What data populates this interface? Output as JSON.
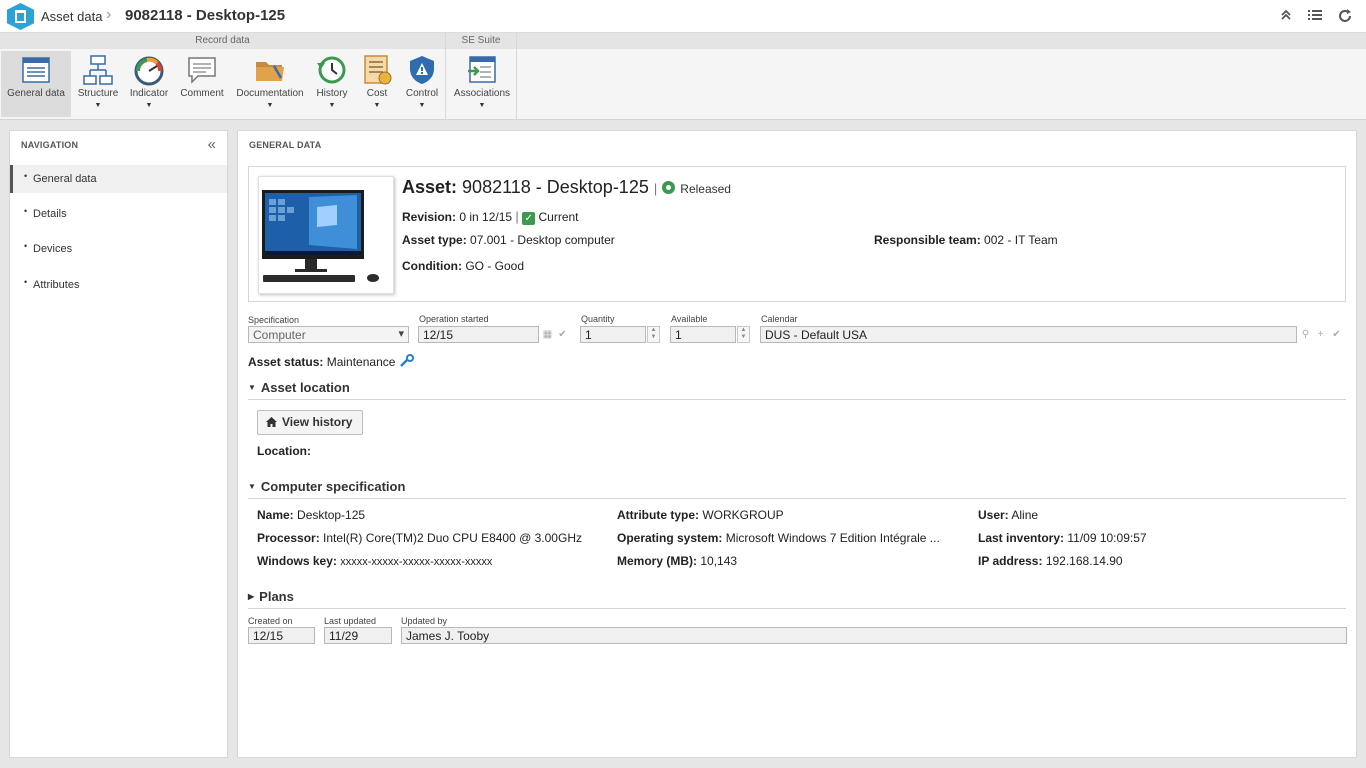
{
  "titlebar": {
    "breadcrumb_root": "Asset data",
    "separator": "›",
    "title": "9082118 - Desktop-125"
  },
  "ribbon": {
    "groups": [
      {
        "label": "Record data"
      },
      {
        "label": "SE Suite"
      }
    ],
    "buttons": [
      {
        "label": "General data",
        "icon": "form-icon",
        "active": true
      },
      {
        "label": "Structure",
        "icon": "structure-icon"
      },
      {
        "label": "Indicator",
        "icon": "gauge-icon"
      },
      {
        "label": "Comment",
        "icon": "comment-icon"
      },
      {
        "label": "Documentation",
        "icon": "folder-icon"
      },
      {
        "label": "History",
        "icon": "history-icon"
      },
      {
        "label": "Cost",
        "icon": "cost-icon"
      },
      {
        "label": "Control",
        "icon": "shield-icon"
      },
      {
        "label": "Associations",
        "icon": "associations-icon"
      }
    ]
  },
  "navigation": {
    "title": "NAVIGATION",
    "items": [
      {
        "label": "General data",
        "active": true
      },
      {
        "label": "Details"
      },
      {
        "label": "Devices"
      },
      {
        "label": "Attributes"
      }
    ]
  },
  "main": {
    "title": "GENERAL DATA",
    "asset": {
      "title_label": "Asset:",
      "title_value": "9082118 - Desktop-125",
      "status": "Released",
      "revision_label": "Revision:",
      "revision_value": "0 in 12/15",
      "revision_status": "Current",
      "asset_type_label": "Asset type:",
      "asset_type_value": "07.001 - Desktop computer",
      "responsible_team_label": "Responsible team:",
      "responsible_team_value": "002 - IT Team",
      "condition_label": "Condition:",
      "condition_value": "GO - Good"
    },
    "fields": {
      "specification_label": "Specification",
      "specification_value": "Computer",
      "operation_started_label": "Operation started",
      "operation_started_value": "12/15",
      "quantity_label": "Quantity",
      "quantity_value": "1",
      "available_label": "Available",
      "available_value": "1",
      "calendar_label": "Calendar",
      "calendar_value": "DUS - Default USA"
    },
    "asset_status_label": "Asset status:",
    "asset_status_value": "Maintenance",
    "location_section": {
      "title": "Asset location",
      "view_history_button": "View history",
      "location_label": "Location:"
    },
    "computer_spec": {
      "title": "Computer specification",
      "name_label": "Name:",
      "name_value": "Desktop-125",
      "processor_label": "Processor:",
      "processor_value": "Intel(R) Core(TM)2 Duo CPU E8400 @ 3.00GHz",
      "windows_key_label": "Windows key:",
      "windows_key_value": "xxxxx-xxxxx-xxxxx-xxxxx-xxxxx",
      "attribute_type_label": "Attribute type:",
      "attribute_type_value": "WORKGROUP",
      "os_label": "Operating system:",
      "os_value": "Microsoft Windows 7 Edition Intégrale ...",
      "memory_label": "Memory (MB):",
      "memory_value": "10,143",
      "user_label": "User:",
      "user_value": "Aline",
      "last_inventory_label": "Last inventory:",
      "last_inventory_value": "11/09 10:09:57",
      "ip_label": "IP address:",
      "ip_value": "192.168.14.90"
    },
    "plans_section": {
      "title": "Plans"
    },
    "footer": {
      "created_on_label": "Created on",
      "created_on_value": "12/15",
      "last_updated_label": "Last updated",
      "last_updated_value": "11/29",
      "updated_by_label": "Updated by",
      "updated_by_value": "James J. Tooby"
    }
  },
  "colors": {
    "accent_blue": "#2aa3d8",
    "ok_green": "#3c9a4e"
  }
}
